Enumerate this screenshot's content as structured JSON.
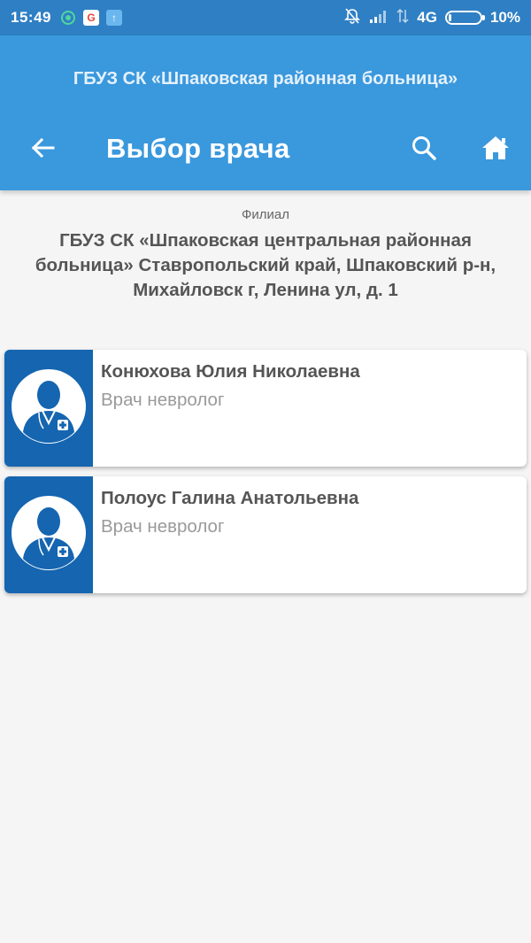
{
  "status_bar": {
    "time": "15:49",
    "network": "4G",
    "battery_percent": "10%",
    "battery_level": 0.1,
    "icons": [
      "notification-app-icon",
      "google-icon",
      "upload-icon",
      "mute-bell-icon",
      "signal-icon",
      "data-arrows-icon",
      "battery-icon"
    ]
  },
  "header": {
    "org_title": "ГБУЗ СК «Шпаковская районная больница»",
    "page_title": "Выбор врача",
    "icons": [
      "back-arrow-icon",
      "search-icon",
      "home-icon"
    ]
  },
  "branch": {
    "caption": "Филиал",
    "name": "ГБУЗ СК «Шпаковская центральная районная больница» Ставропольский край, Шпаковский р-н, Михайловск г, Ленина ул, д. 1"
  },
  "doctors": [
    {
      "name": "Конюхова Юлия Николаевна",
      "specialty": "Врач невролог",
      "avatar_icon": "doctor-avatar-icon"
    },
    {
      "name": "Полоус Галина Анатольевна",
      "specialty": "Врач невролог",
      "avatar_icon": "doctor-avatar-icon"
    }
  ],
  "colors": {
    "status_bar": "#2f7fc4",
    "header": "#3a98dd",
    "avatar_bg": "#1565b0",
    "background": "#f5f5f5"
  }
}
